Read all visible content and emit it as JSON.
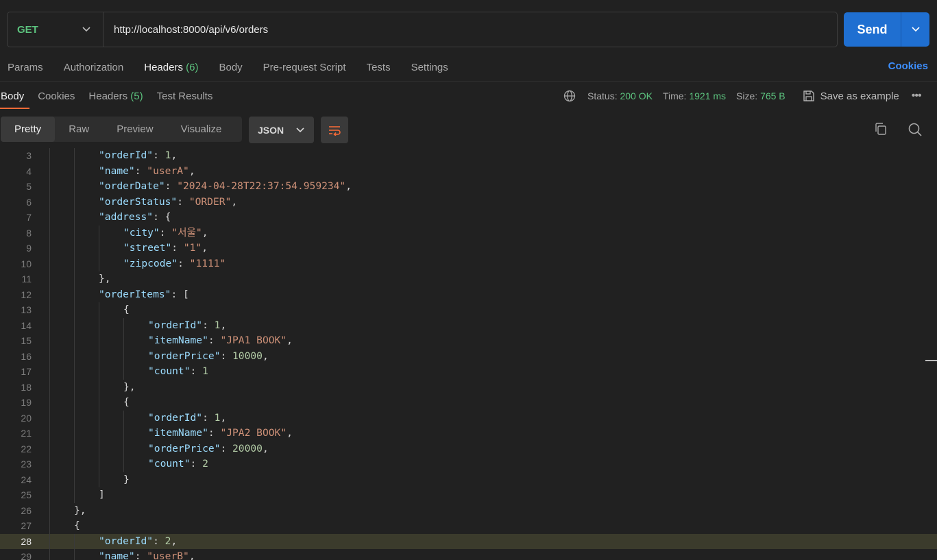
{
  "request": {
    "method": "GET",
    "url": "http://localhost:8000/api/v6/orders",
    "send_label": "Send"
  },
  "request_tabs": {
    "params": "Params",
    "authorization": "Authorization",
    "headers": "Headers",
    "headers_count": "(6)",
    "body": "Body",
    "prerequest": "Pre-request Script",
    "tests": "Tests",
    "settings": "Settings",
    "cookies": "Cookies"
  },
  "response_tabs": {
    "body": "Body",
    "cookies": "Cookies",
    "headers": "Headers",
    "headers_count": "(5)",
    "test_results": "Test Results"
  },
  "response_status": {
    "status_label": "Status:",
    "status_value": "200 OK",
    "time_label": "Time:",
    "time_value": "1921 ms",
    "size_label": "Size:",
    "size_value": "765 B",
    "save_example": "Save as example",
    "more": "•••"
  },
  "format_toolbar": {
    "pretty": "Pretty",
    "raw": "Raw",
    "preview": "Preview",
    "visualize": "Visualize",
    "language": "JSON"
  },
  "code_lines": [
    {
      "n": "3",
      "indent": 2,
      "tokens": [
        [
          "k",
          "\"orderId\""
        ],
        [
          "p",
          ": "
        ],
        [
          "n",
          "1"
        ],
        [
          "p",
          ","
        ]
      ]
    },
    {
      "n": "4",
      "indent": 2,
      "tokens": [
        [
          "k",
          "\"name\""
        ],
        [
          "p",
          ": "
        ],
        [
          "s",
          "\"userA\""
        ],
        [
          "p",
          ","
        ]
      ]
    },
    {
      "n": "5",
      "indent": 2,
      "tokens": [
        [
          "k",
          "\"orderDate\""
        ],
        [
          "p",
          ": "
        ],
        [
          "s",
          "\"2024-04-28T22:37:54.959234\""
        ],
        [
          "p",
          ","
        ]
      ]
    },
    {
      "n": "6",
      "indent": 2,
      "tokens": [
        [
          "k",
          "\"orderStatus\""
        ],
        [
          "p",
          ": "
        ],
        [
          "s",
          "\"ORDER\""
        ],
        [
          "p",
          ","
        ]
      ]
    },
    {
      "n": "7",
      "indent": 2,
      "tokens": [
        [
          "k",
          "\"address\""
        ],
        [
          "p",
          ": {"
        ]
      ]
    },
    {
      "n": "8",
      "indent": 3,
      "tokens": [
        [
          "k",
          "\"city\""
        ],
        [
          "p",
          ": "
        ],
        [
          "s",
          "\"서울\""
        ],
        [
          "p",
          ","
        ]
      ]
    },
    {
      "n": "9",
      "indent": 3,
      "tokens": [
        [
          "k",
          "\"street\""
        ],
        [
          "p",
          ": "
        ],
        [
          "s",
          "\"1\""
        ],
        [
          "p",
          ","
        ]
      ]
    },
    {
      "n": "10",
      "indent": 3,
      "tokens": [
        [
          "k",
          "\"zipcode\""
        ],
        [
          "p",
          ": "
        ],
        [
          "s",
          "\"1111\""
        ]
      ]
    },
    {
      "n": "11",
      "indent": 2,
      "tokens": [
        [
          "p",
          "},"
        ]
      ]
    },
    {
      "n": "12",
      "indent": 2,
      "tokens": [
        [
          "k",
          "\"orderItems\""
        ],
        [
          "p",
          ": ["
        ]
      ]
    },
    {
      "n": "13",
      "indent": 3,
      "tokens": [
        [
          "p",
          "{"
        ]
      ]
    },
    {
      "n": "14",
      "indent": 4,
      "tokens": [
        [
          "k",
          "\"orderId\""
        ],
        [
          "p",
          ": "
        ],
        [
          "n",
          "1"
        ],
        [
          "p",
          ","
        ]
      ]
    },
    {
      "n": "15",
      "indent": 4,
      "tokens": [
        [
          "k",
          "\"itemName\""
        ],
        [
          "p",
          ": "
        ],
        [
          "s",
          "\"JPA1 BOOK\""
        ],
        [
          "p",
          ","
        ]
      ]
    },
    {
      "n": "16",
      "indent": 4,
      "tokens": [
        [
          "k",
          "\"orderPrice\""
        ],
        [
          "p",
          ": "
        ],
        [
          "n",
          "10000"
        ],
        [
          "p",
          ","
        ]
      ]
    },
    {
      "n": "17",
      "indent": 4,
      "tokens": [
        [
          "k",
          "\"count\""
        ],
        [
          "p",
          ": "
        ],
        [
          "n",
          "1"
        ]
      ]
    },
    {
      "n": "18",
      "indent": 3,
      "tokens": [
        [
          "p",
          "},"
        ]
      ]
    },
    {
      "n": "19",
      "indent": 3,
      "tokens": [
        [
          "p",
          "{"
        ]
      ]
    },
    {
      "n": "20",
      "indent": 4,
      "tokens": [
        [
          "k",
          "\"orderId\""
        ],
        [
          "p",
          ": "
        ],
        [
          "n",
          "1"
        ],
        [
          "p",
          ","
        ]
      ]
    },
    {
      "n": "21",
      "indent": 4,
      "tokens": [
        [
          "k",
          "\"itemName\""
        ],
        [
          "p",
          ": "
        ],
        [
          "s",
          "\"JPA2 BOOK\""
        ],
        [
          "p",
          ","
        ]
      ]
    },
    {
      "n": "22",
      "indent": 4,
      "tokens": [
        [
          "k",
          "\"orderPrice\""
        ],
        [
          "p",
          ": "
        ],
        [
          "n",
          "20000"
        ],
        [
          "p",
          ","
        ]
      ]
    },
    {
      "n": "23",
      "indent": 4,
      "tokens": [
        [
          "k",
          "\"count\""
        ],
        [
          "p",
          ": "
        ],
        [
          "n",
          "2"
        ]
      ]
    },
    {
      "n": "24",
      "indent": 3,
      "tokens": [
        [
          "p",
          "}"
        ]
      ]
    },
    {
      "n": "25",
      "indent": 2,
      "tokens": [
        [
          "p",
          "]"
        ]
      ]
    },
    {
      "n": "26",
      "indent": 1,
      "tokens": [
        [
          "p",
          "},"
        ]
      ]
    },
    {
      "n": "27",
      "indent": 1,
      "tokens": [
        [
          "p",
          "{"
        ]
      ]
    },
    {
      "n": "28",
      "indent": 2,
      "tokens": [
        [
          "k",
          "\"orderId\""
        ],
        [
          "p",
          ": "
        ],
        [
          "n",
          "2"
        ],
        [
          "p",
          ","
        ]
      ],
      "highlight": true
    },
    {
      "n": "29",
      "indent": 2,
      "tokens": [
        [
          "k",
          "\"name\""
        ],
        [
          "p",
          ": "
        ],
        [
          "s",
          "\"userB\""
        ],
        [
          "p",
          ","
        ]
      ]
    }
  ]
}
